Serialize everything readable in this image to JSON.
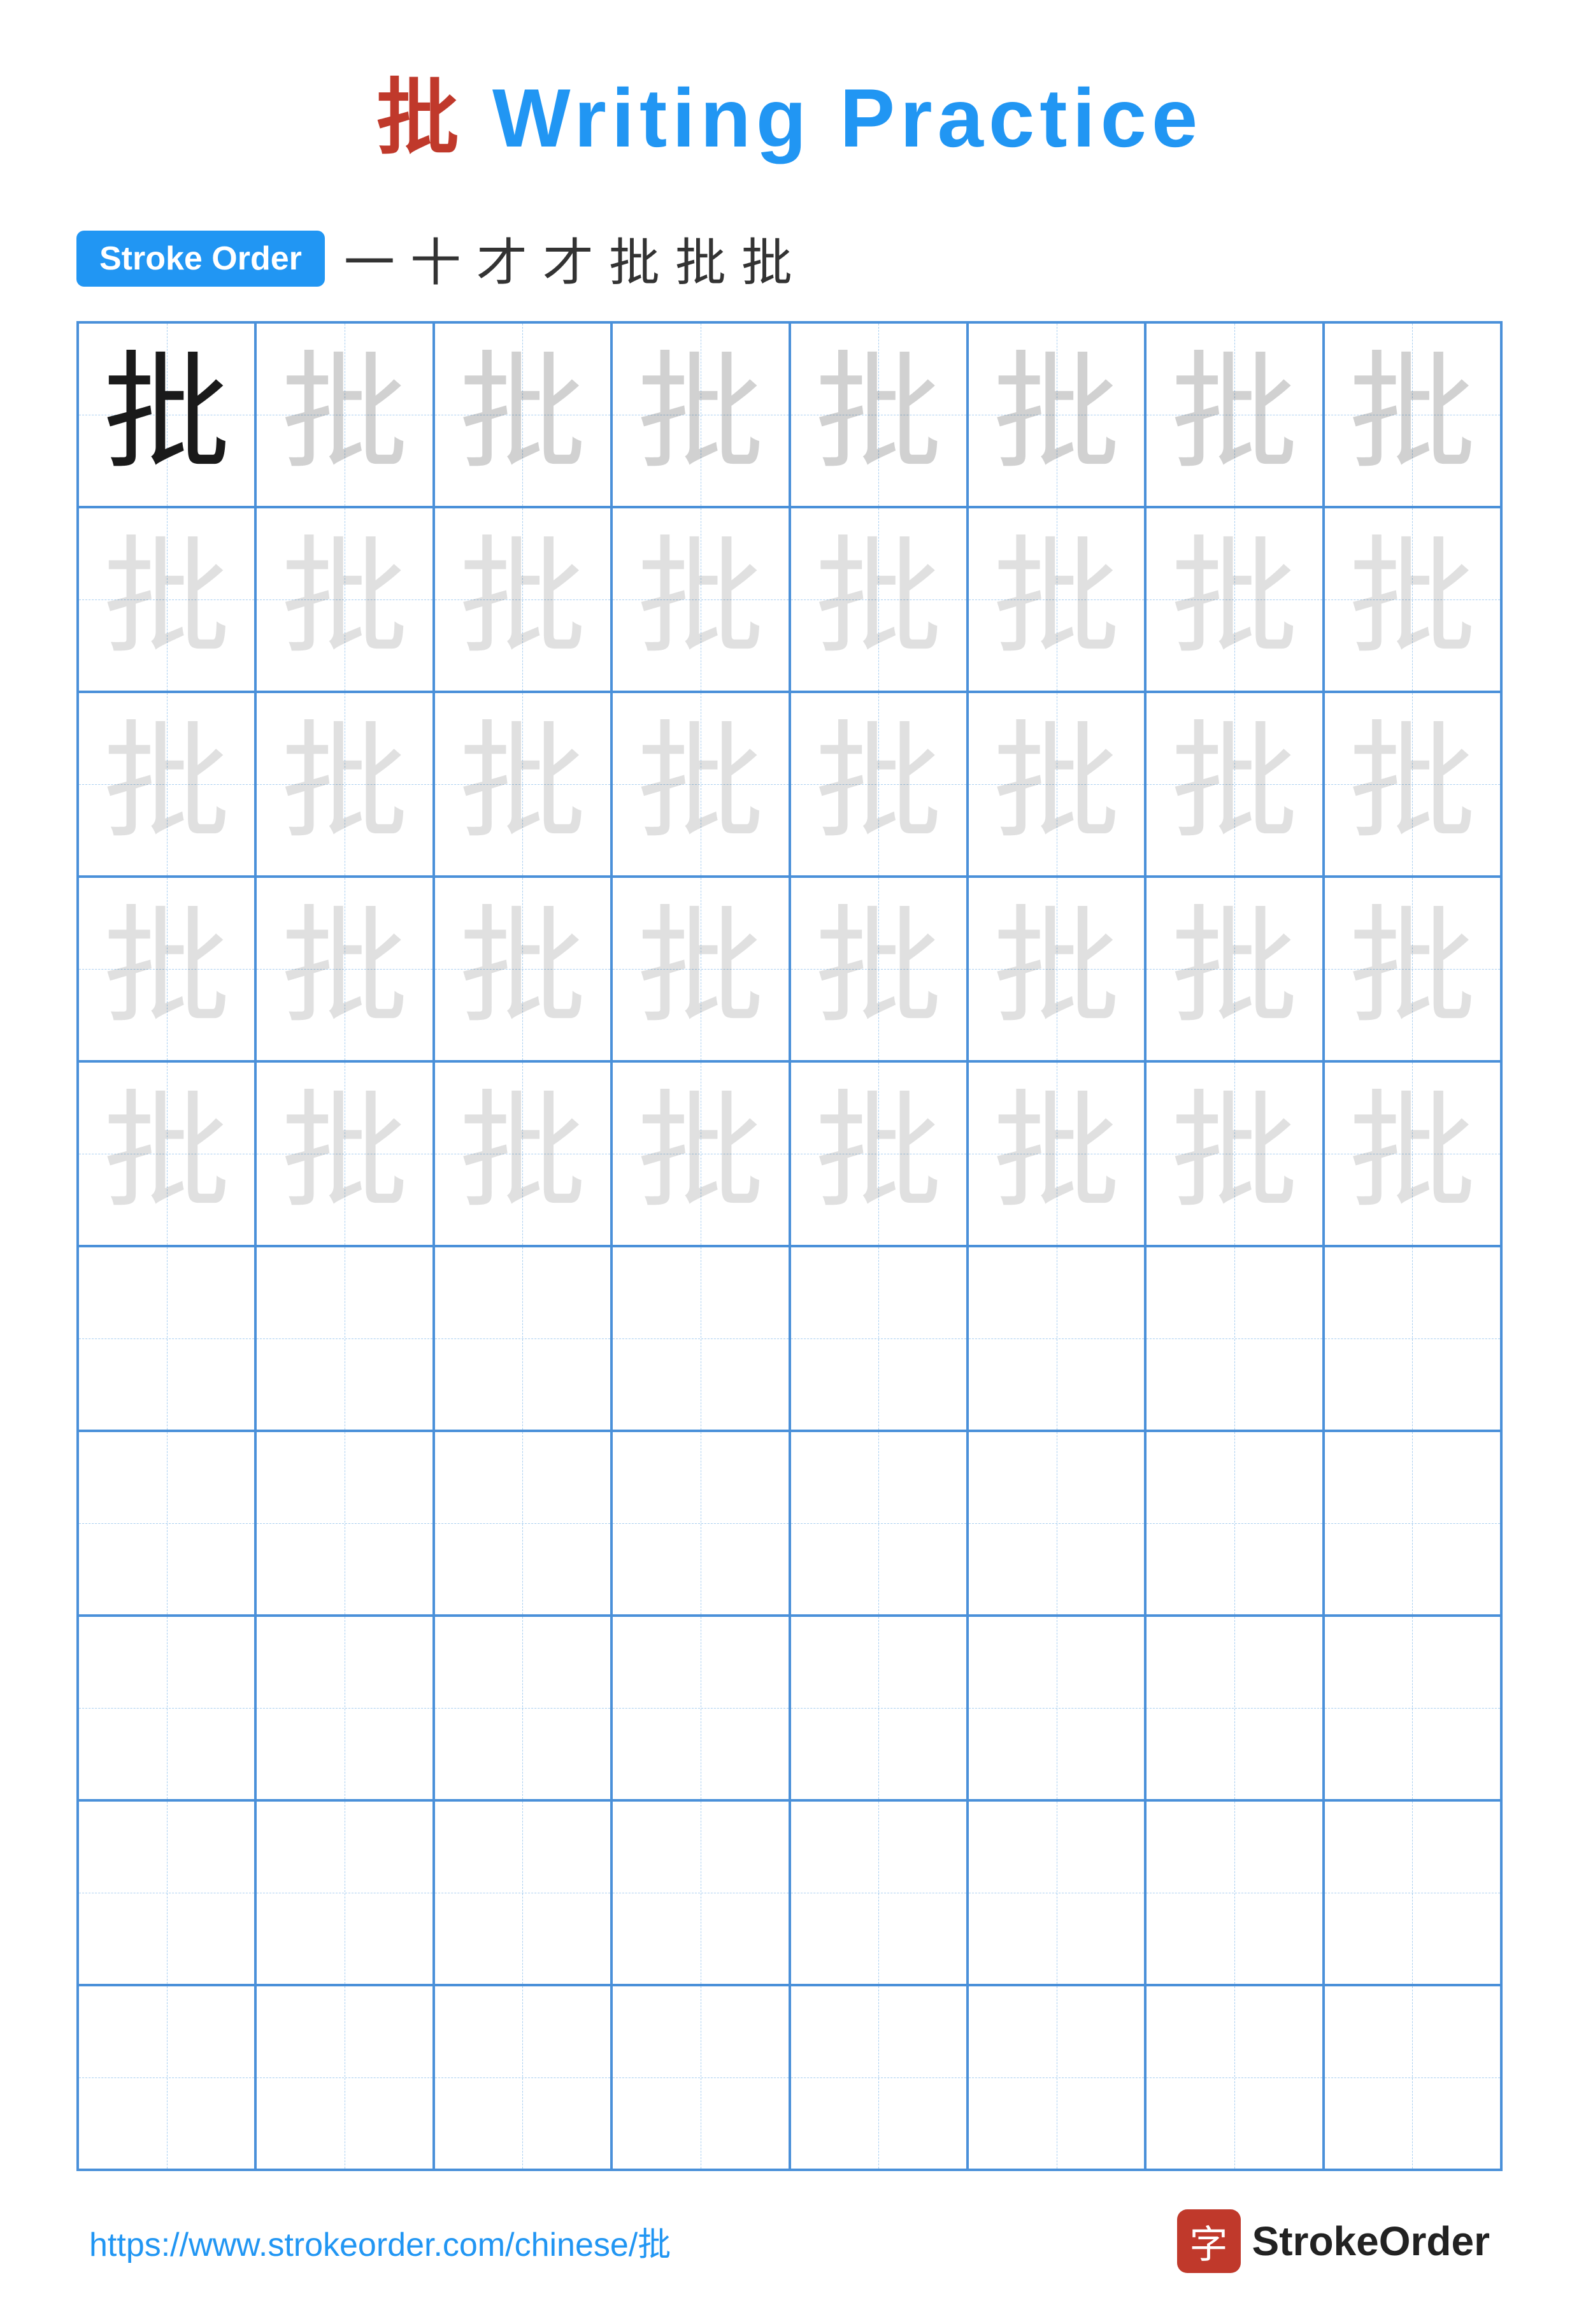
{
  "title": {
    "character": "批",
    "text": " Writing Practice"
  },
  "stroke_order": {
    "badge_label": "Stroke Order",
    "sequence": [
      "一",
      "十",
      "才",
      "才",
      "批",
      "批",
      "批"
    ]
  },
  "grid": {
    "character": "批",
    "rows": 10,
    "cols": 8,
    "row_types": [
      "solid",
      "faded",
      "faded",
      "faded",
      "faded",
      "empty",
      "empty",
      "empty",
      "empty",
      "empty"
    ]
  },
  "footer": {
    "url": "https://www.strokeorder.com/chinese/批",
    "logo_char": "字",
    "logo_text": "StrokeOrder"
  }
}
